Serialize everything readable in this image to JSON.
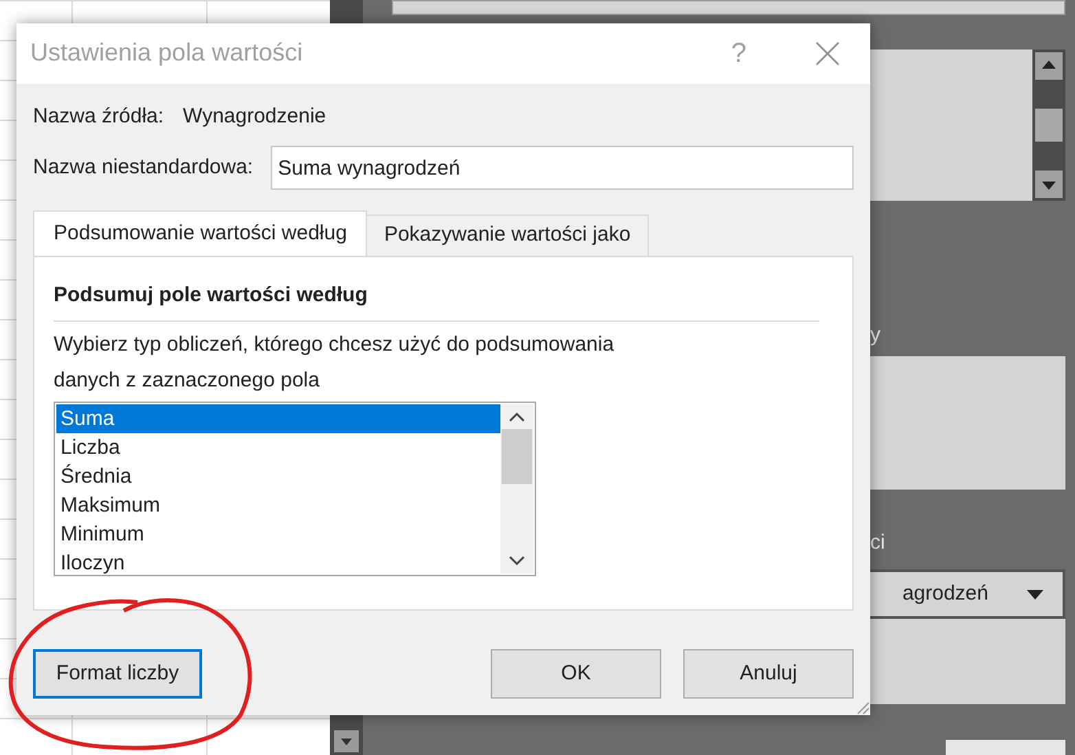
{
  "background": {
    "side_panel": {
      "label_1": "y",
      "label_2": "ci",
      "dropdown_value": "agrodzeń"
    }
  },
  "dialog": {
    "title": "Ustawienia pola wartości",
    "help": "?",
    "source_label": "Nazwa źródła:",
    "source_value": "Wynagrodzenie",
    "custom_name": {
      "label": "Nazwa niestandardowa:",
      "value": "Suma wynagrodzeń"
    },
    "tabs": [
      {
        "label": "Podsumowanie wartości według",
        "selected": true
      },
      {
        "label": "Pokazywanie wartości jako",
        "selected": false
      }
    ],
    "section_title": "Podsumuj pole wartości według",
    "description_lines": [
      "Wybierz typ obliczeń, którego chcesz użyć do podsumowania",
      "danych z zaznaczonego pola"
    ],
    "functions": [
      {
        "label": "Suma",
        "selected": true
      },
      {
        "label": "Liczba",
        "selected": false
      },
      {
        "label": "Średnia",
        "selected": false
      },
      {
        "label": "Maksimum",
        "selected": false
      },
      {
        "label": "Minimum",
        "selected": false
      },
      {
        "label": "Iloczyn",
        "selected": false
      }
    ],
    "buttons": {
      "number_format": "Format liczby",
      "ok": "OK",
      "cancel": "Anuluj"
    }
  }
}
